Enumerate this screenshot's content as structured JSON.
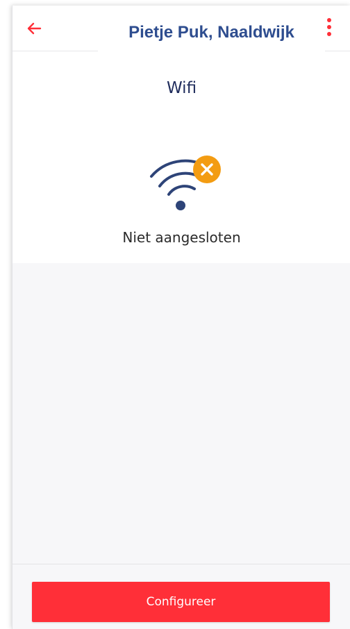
{
  "header": {
    "title": "Pietje Puk, Naaldwijk",
    "back_icon": "arrow-left-icon",
    "menu_icon": "more-vertical-icon",
    "accent_color": "#ff2f38",
    "title_color": "#2e4d8f"
  },
  "main": {
    "section_title": "Wifi",
    "status_icon": "wifi-disconnected-icon",
    "status_badge_color": "#f39c12",
    "status_text": "Niet aangesloten"
  },
  "footer": {
    "configure_label": "Configureer",
    "button_color": "#ff2f38"
  }
}
